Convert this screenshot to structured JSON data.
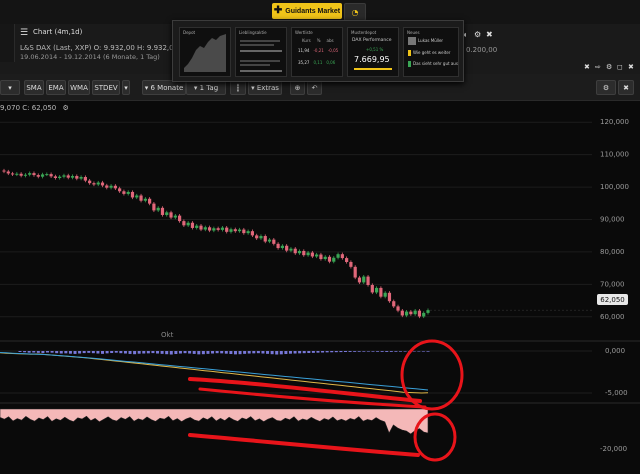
{
  "topbar": {
    "guidants_label": "Guidants Market"
  },
  "chart_header": {
    "title": "Chart (4m,1d)",
    "instrument": "L&S DAX (Last, XXP)",
    "open": "O: 9.932,00",
    "high": "H: 9.932,0",
    "date_range": "19.06.2014 - 19.12.2014 (6 Monate, 1 Tag)",
    "right_value": "0.200,00"
  },
  "guidants_tiles": {
    "tile1": {
      "title": "Depot"
    },
    "tile2": {
      "title": "Lieblingsaktie"
    },
    "tile3": {
      "title": "Wertliste",
      "cols": [
        "Kurs",
        "%",
        "abs"
      ],
      "row1": [
        "11,94",
        "-0,21",
        "-0,05"
      ],
      "row2": [
        "35,27",
        "0,11",
        "0,06"
      ]
    },
    "tile4": {
      "title": "Musterdepot",
      "name": "DAX Performance",
      "change": "+0,51 %",
      "value": "7.669,95"
    },
    "tile5": {
      "title": "Neues",
      "item1": "Lukas Müller",
      "item2": "Wie geht es weiter",
      "item3": "Das sieht sehr gut aus"
    }
  },
  "toolbar": {
    "sma": "SMA",
    "ema": "EMA",
    "wma": "WMA",
    "stdev": "STDEV",
    "period": "6 Monate",
    "interval": "1 Tag",
    "extras": "Extras"
  },
  "chart_info": "9,070 C: 62,050",
  "price_badge": "62,050",
  "month_label": "Okt",
  "colors": {
    "up": "#3aa655",
    "down": "#e0677a",
    "accent": "#f0c419",
    "annotation": "#e8141a"
  },
  "chart_data": [
    {
      "type": "candlestick",
      "title": "",
      "y_ticks": [
        "120,000",
        "110,000",
        "100,000",
        "90,000",
        "80,000",
        "70,000",
        "60,000"
      ],
      "ylim": [
        55000,
        125000
      ],
      "last_price": 62050,
      "close_series": [
        104800,
        104200,
        103900,
        104100,
        103500,
        103800,
        104300,
        103700,
        103200,
        103900,
        104000,
        103300,
        102800,
        103200,
        103600,
        102900,
        103400,
        102600,
        103100,
        102000,
        101200,
        100800,
        101400,
        100500,
        99800,
        100400,
        99600,
        98700,
        97900,
        98500,
        96800,
        97400,
        95800,
        96400,
        94900,
        92800,
        93600,
        91400,
        92200,
        90600,
        91200,
        89500,
        88200,
        89000,
        87400,
        88100,
        86900,
        87600,
        86600,
        87300,
        86800,
        87500,
        86200,
        87000,
        86400,
        86900,
        85800,
        86400,
        85100,
        84200,
        84900,
        83200,
        83800,
        82500,
        81200,
        81900,
        80400,
        81000,
        79600,
        80300,
        79000,
        79800,
        78600,
        79200,
        77800,
        78500,
        77000,
        78200,
        79300,
        78100,
        76900,
        75400,
        72100,
        70600,
        72400,
        69800,
        67500,
        68900,
        66200,
        67400,
        64800,
        63200,
        61900,
        60400,
        61600,
        60800,
        61900,
        60100,
        61200,
        62050
      ],
      "grid": true
    },
    {
      "type": "line",
      "title": "",
      "y_ticks": [
        "0,000",
        "-5,000"
      ],
      "histogram": [
        -120,
        -150,
        -200,
        -180,
        -220,
        -250,
        -180,
        -200,
        -260,
        -300,
        -280,
        -320,
        -350,
        -300,
        -250,
        -220,
        -260,
        -300,
        -340,
        -280,
        -240,
        -200,
        -260,
        -300,
        -350,
        -380,
        -320,
        -300,
        -280,
        -250,
        -300,
        -340,
        -380,
        -420,
        -360,
        -300,
        -260,
        -300,
        -350,
        -400,
        -380,
        -340,
        -300,
        -260,
        -280,
        -320,
        -360,
        -400,
        -380,
        -340,
        -300,
        -280,
        -260,
        -300,
        -340,
        -380,
        -420,
        -400,
        -360,
        -320,
        -300,
        -280,
        -260,
        -240,
        -220,
        -200,
        -180,
        -160,
        -150,
        -140,
        -130,
        -120,
        -110,
        -100,
        -90,
        -80,
        -70,
        -80,
        -90,
        -100,
        -110,
        -100,
        -90,
        -80,
        -70,
        -60,
        -50,
        -60,
        -70,
        -80
      ],
      "series": [
        {
          "values": [
            -200,
            -260,
            -300,
            -320,
            -350,
            -380,
            -360,
            -400,
            -460,
            -520,
            -580,
            -640,
            -700,
            -760,
            -820,
            -900,
            -980,
            -1060,
            -1140,
            -1220,
            -1300,
            -1380,
            -1460,
            -1540,
            -1620,
            -1700,
            -1780,
            -1860,
            -1940,
            -2020,
            -2100,
            -2180,
            -2260,
            -2340,
            -2420,
            -2500,
            -2580,
            -2660,
            -2740,
            -2820,
            -2900,
            -2980,
            -3060,
            -3140,
            -3220,
            -3300,
            -3380,
            -3460,
            -3540,
            -3620,
            -3700,
            -3780,
            -3860,
            -3940,
            -4020,
            -4100,
            -4180,
            -4260,
            -4340,
            -4420,
            -4500,
            -4580,
            -4660,
            -4740,
            -4820,
            -4900,
            -4940,
            -4980,
            -5000,
            -4980
          ]
        },
        {
          "values": [
            -180,
            -220,
            -260,
            -300,
            -330,
            -360,
            -380,
            -420,
            -470,
            -520,
            -570,
            -620,
            -680,
            -740,
            -800,
            -860,
            -930,
            -1000,
            -1070,
            -1140,
            -1210,
            -1280,
            -1350,
            -1420,
            -1490,
            -1560,
            -1630,
            -1700,
            -1770,
            -1840,
            -1910,
            -1980,
            -2050,
            -2120,
            -2190,
            -2260,
            -2330,
            -2400,
            -2470,
            -2540,
            -2610,
            -2680,
            -2750,
            -2820,
            -2890,
            -2960,
            -3030,
            -3100,
            -3170,
            -3240,
            -3310,
            -3380,
            -3450,
            -3520,
            -3590,
            -3660,
            -3730,
            -3800,
            -3870,
            -3940,
            -4010,
            -4080,
            -4150,
            -4220,
            -4290,
            -4360,
            -4430,
            -4500,
            -4570,
            -4640
          ]
        }
      ]
    },
    {
      "type": "area",
      "title": "",
      "y_ticks": [
        "-20,000"
      ],
      "values": [
        -4200,
        -5100,
        -3900,
        -6000,
        -4800,
        -5600,
        -3700,
        -5200,
        -6100,
        -4500,
        -5300,
        -3800,
        -6200,
        -4900,
        -5700,
        -4100,
        -5500,
        -6300,
        -4400,
        -5000,
        -3600,
        -5800,
        -4700,
        -6400,
        -5100,
        -3900,
        -5400,
        -6000,
        -4300,
        -5200,
        -3800,
        -6100,
        -4900,
        -5600,
        -4000,
        -5300,
        -6200,
        -4600,
        -5100,
        -3700,
        -5900,
        -4800,
        -6300,
        -5000,
        -4200,
        -5500,
        -6100,
        -4400,
        -5300,
        -3900,
        -6000,
        -4700,
        -5800,
        -4100,
        -5400,
        -6200,
        -4500,
        -5200,
        -3800,
        -5900,
        -4900,
        -6300,
        -5100,
        -4300,
        -5700,
        -6000,
        -4600,
        -5400,
        -3900,
        -6100,
        -5000,
        -5600,
        -4200,
        -5300,
        -6200,
        -4800,
        -5500,
        -4000,
        -5900,
        -5100,
        -6000,
        -4700,
        -5400,
        -3800,
        -6100,
        -5200,
        -5800,
        -4300,
        -5600,
        -6400,
        -12000,
        -8000,
        -9500,
        -10500,
        -11000,
        -12500,
        -10800,
        -9800,
        -11500,
        -12000
      ],
      "ylim": [
        -22000,
        0
      ]
    }
  ]
}
